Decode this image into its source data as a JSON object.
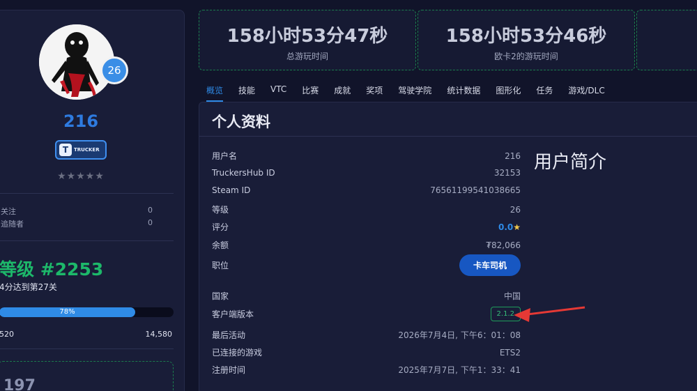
{
  "sidebar": {
    "level": "26",
    "username": "216",
    "badge_text": "TRUCKER",
    "badge_logo": "T",
    "stars": "★★★★★",
    "follow": [
      {
        "label": "关注",
        "value": "0"
      },
      {
        "label": "追随者",
        "value": "0"
      }
    ],
    "rank": "等级 #2253",
    "rank_sub": "4分达到第27关",
    "progress": 78,
    "progress_label": "78%",
    "xp_left": "520",
    "xp_right": "14,580",
    "bottom_value": "197"
  },
  "stats": [
    {
      "value": "158小时53分47秒",
      "label": "总游玩时间"
    },
    {
      "value": "158小时53分46秒",
      "label": "欧卡2的游玩时间"
    }
  ],
  "tabs": [
    "概览",
    "技能",
    "VTC",
    "比赛",
    "成就",
    "奖项",
    "驾驶学院",
    "统计数据",
    "图形化",
    "任务",
    "游戏/DLC"
  ],
  "active_tab": 0,
  "profile": {
    "title": "个人资料",
    "bio_title": "用户简介",
    "username_label": "用户名",
    "username_value": "216",
    "hubid_label": "TruckersHub ID",
    "hubid_value": "32153",
    "steam_label": "Steam ID",
    "steam_value": "76561199541038665",
    "level_label": "等级",
    "level_value": "26",
    "rating_label": "评分",
    "rating_value": "0.0",
    "balance_label": "余额",
    "balance_value": "₮82,066",
    "role_label": "职位",
    "role_value": "卡车司机",
    "country_label": "国家",
    "country_value": "中国",
    "client_label": "客户端版本",
    "client_value": "2.1.2",
    "last_label": "最后活动",
    "last_value": "2026年7月4日, 下午6：01：08",
    "game_label": "已连接的游戏",
    "game_value": "ETS2",
    "reg_label": "注册时间",
    "reg_value": "2025年7月7日, 下午1：33：41"
  },
  "colors": {
    "accent": "#2e8ae6",
    "green": "#1db86a",
    "arrow": "#e53935"
  }
}
